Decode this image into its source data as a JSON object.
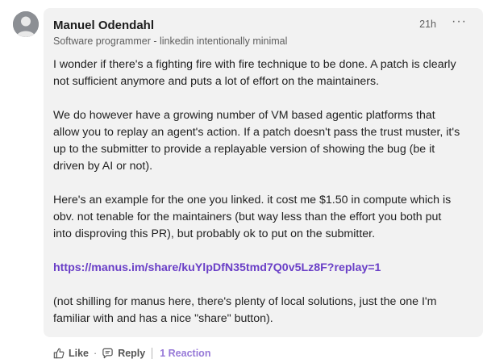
{
  "comment": {
    "author": "Manuel Odendahl",
    "headline": "Software programmer - linkedin intentionally minimal",
    "time": "21h",
    "more_label": "···",
    "paragraphs": [
      "I wonder if there's a fighting fire with fire technique to be done. A patch is clearly not sufficient anymore and puts a lot of effort on the maintainers.",
      "We do however have a growing number of VM based agentic platforms that allow you to replay an agent's action. If a patch doesn't pass the trust muster, it's up to the submitter to provide a replayable version of showing the bug (be it driven by AI or not).",
      "Here's an example for the one you linked. it cost me $1.50 in compute which is obv. not tenable for the maintainers (but way less than the effort you both put into disproving this PR), but probably ok to put on the submitter."
    ],
    "link": "https://manus.im/share/kuYlpDfN35tmd7Q0v5Lz8F?replay=1",
    "closing": "(not shilling for manus here, there's plenty of local solutions, just the one I'm familiar with and has a nice \"share\" button)."
  },
  "actions": {
    "like_label": "Like",
    "dot": "·",
    "reply_label": "Reply",
    "reactions_label": "1 Reaction"
  },
  "colors": {
    "bubble_bg": "#f2f2f2",
    "link": "#6a3fc7",
    "avatar": "#8c8f94"
  },
  "icons": {
    "avatar": "default-person-avatar",
    "like": "thumbs-up-icon",
    "reply": "speech-bubble-icon"
  }
}
